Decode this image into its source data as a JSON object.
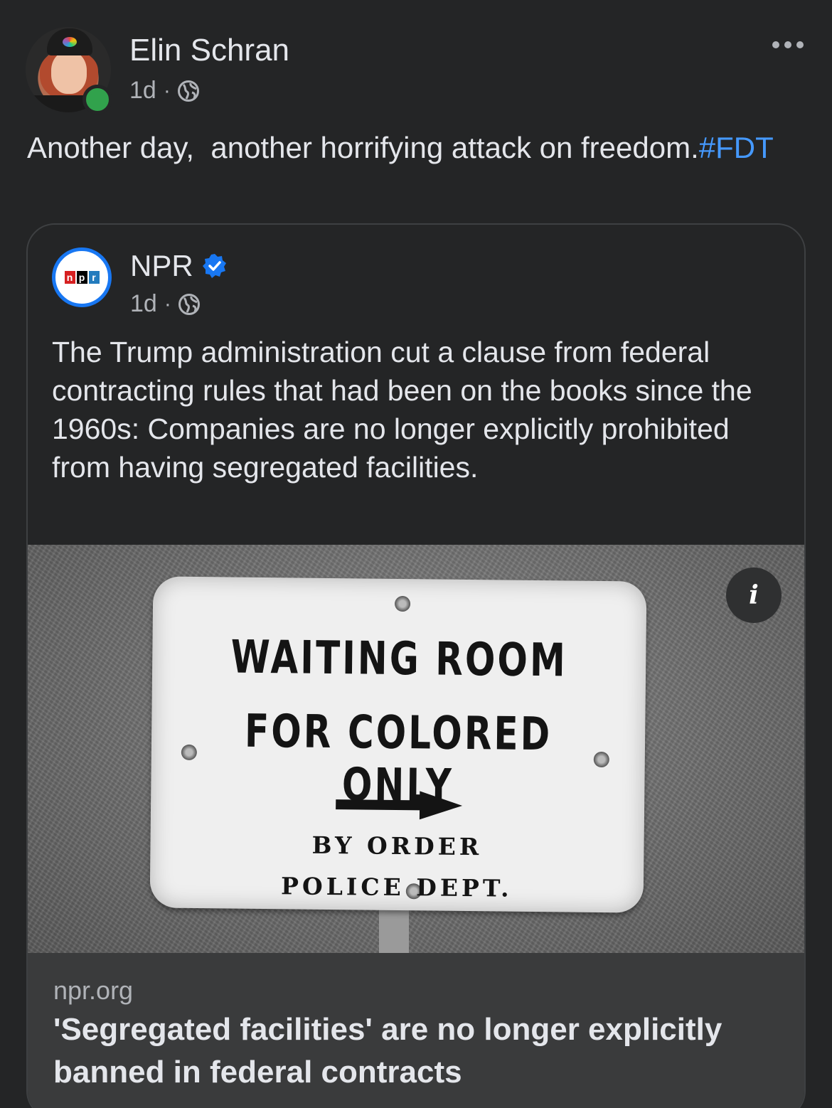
{
  "post": {
    "author_name": "Elin Schran",
    "time": "1d",
    "separator": "·",
    "privacy_icon": "globe-icon",
    "more_icon": "more-options-icon",
    "text": "Another day,  another horrifying attack on freedom.",
    "hashtag": "#FDT"
  },
  "shared_post": {
    "page_name": "NPR",
    "verified_icon": "verified-badge-icon",
    "logo_letters": [
      "n",
      "p",
      "r"
    ],
    "time": "1d",
    "separator": "·",
    "text": "The Trump administration cut a clause from federal contracting rules that had been on the books since the 1960s: Companies are no longer explicitly prohibited from having segregated facilities.",
    "image": {
      "sign_line1": "WAITING  ROOM",
      "sign_line2": "FOR COLORED ONLY",
      "sign_line3": "BY ORDER",
      "sign_line4": "POLICE DEPT.",
      "info_label": "i"
    },
    "link": {
      "domain": "npr.org",
      "title": "'Segregated facilities' are no longer explicitly banned in federal contracts"
    }
  },
  "colors": {
    "background": "#242526",
    "hashtag": "#4599ff",
    "online": "#31a24c",
    "verified": "#1877f2"
  }
}
